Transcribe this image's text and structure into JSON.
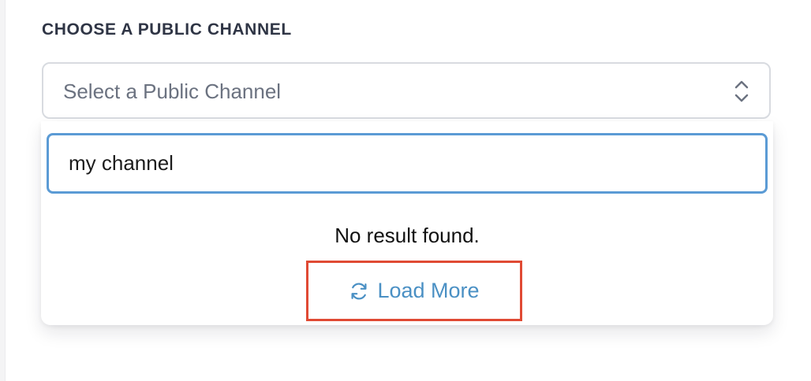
{
  "section": {
    "label": "CHOOSE A PUBLIC CHANNEL"
  },
  "select": {
    "placeholder": "Select a Public Channel",
    "icon": "chevron-updown-icon"
  },
  "search": {
    "value": "my channel"
  },
  "results": {
    "empty_message": "No result found."
  },
  "load_more": {
    "label": "Load More",
    "icon": "refresh-icon"
  },
  "colors": {
    "input_focus_border": "#5b9bd5",
    "load_more_text": "#4a90c4",
    "highlight_box": "#e04a34",
    "label_text": "#2f3545"
  }
}
